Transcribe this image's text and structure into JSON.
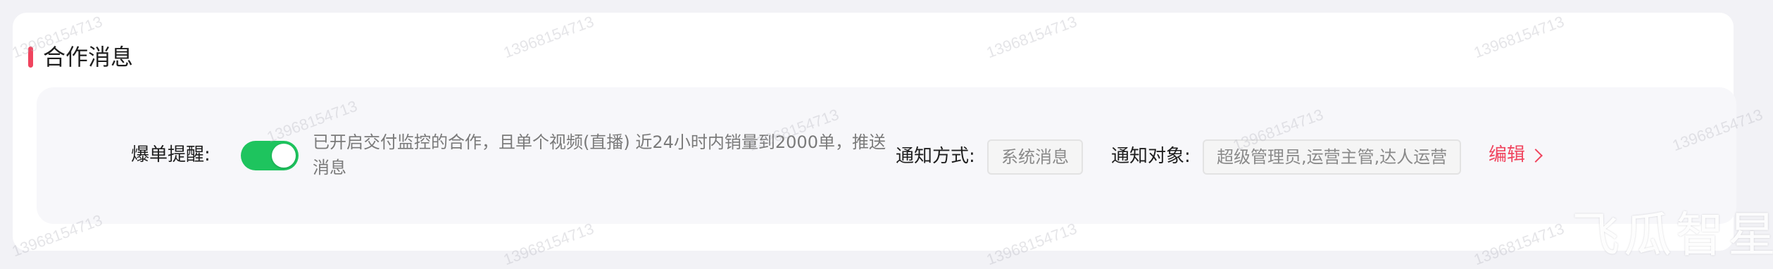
{
  "section": {
    "title": "合作消息"
  },
  "reminder": {
    "label": "爆单提醒:",
    "toggle_on": true,
    "description": "已开启交付监控的合作，且单个视频(直播) 近24小时内销量到2000单，推送消息"
  },
  "notify_method": {
    "label": "通知方式:",
    "value": "系统消息"
  },
  "notify_target": {
    "label": "通知对象:",
    "value": "超级管理员,运营主管,达人运营"
  },
  "edit": {
    "label": "编辑"
  },
  "watermark": {
    "text": "13968154713"
  },
  "brand": {
    "text": "飞瓜智星"
  },
  "colors": {
    "accent": "#f0445e",
    "toggle": "#1ec45e"
  }
}
